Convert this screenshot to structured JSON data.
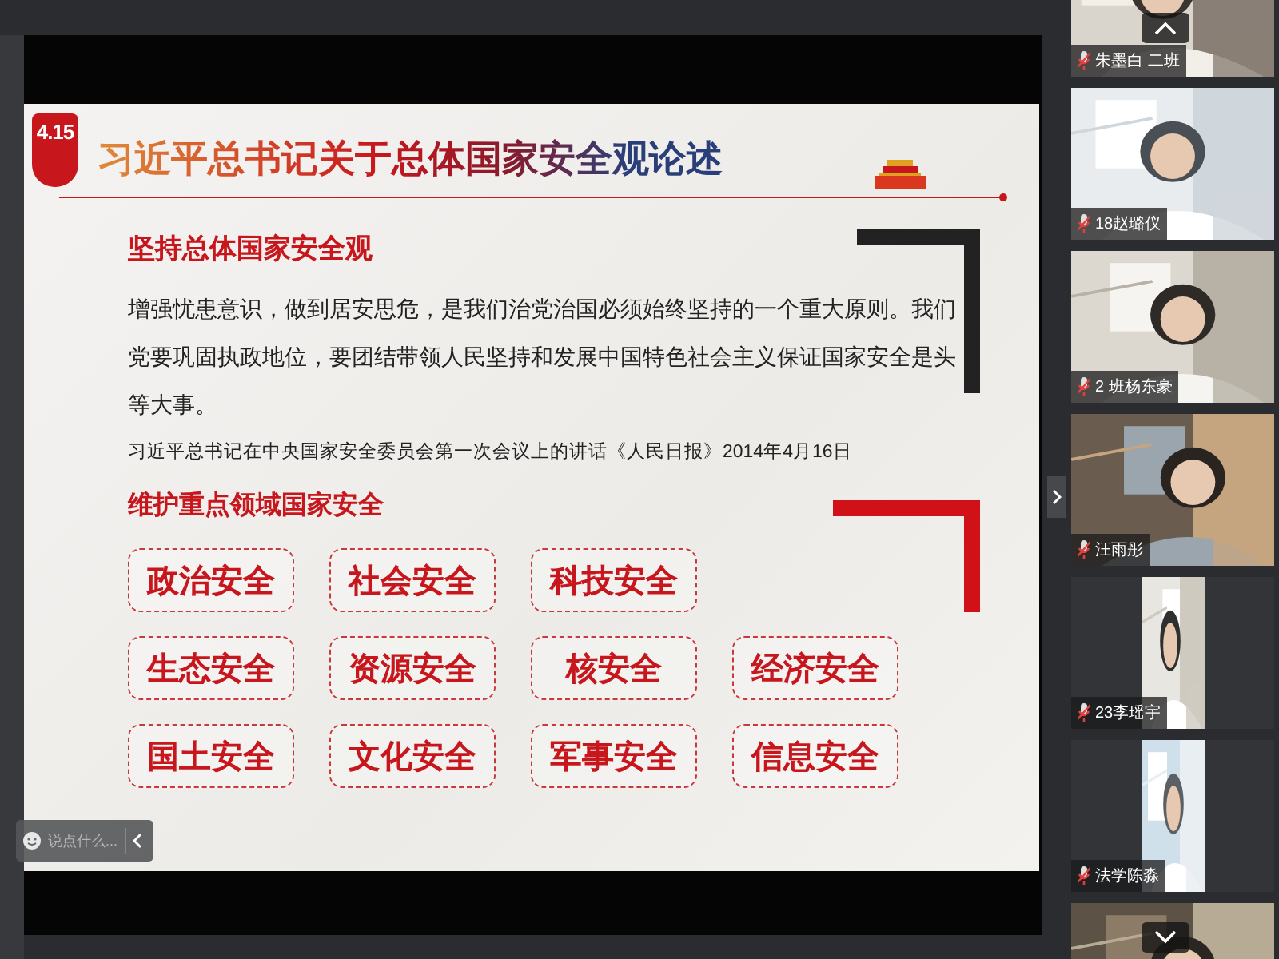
{
  "slide": {
    "logo_text": "4.15",
    "title": "习近平总书记关于总体国家安全观论述",
    "heading": "坚持总体国家安全观",
    "body": "增强忧患意识，做到居安思危，是我们治党治国必须始终坚持的一个重大原则。我们党要巩固执政地位，要团结带领人民坚持和发展中国特色社会主义保证国家安全是头等大事。",
    "citation": "习近平总书记在中央国家安全委员会第一次会议上的讲话《人民日报》2014年4月16日",
    "subheading": "维护重点领域国家安全",
    "areas": [
      [
        "政治安全",
        "社会安全",
        "科技安全"
      ],
      [
        "生态安全",
        "资源安全",
        "核安全",
        "经济安全"
      ],
      [
        "国土安全",
        "文化安全",
        "军事安全",
        "信息安全"
      ]
    ]
  },
  "chat": {
    "placeholder": "说点什么..."
  },
  "participants": [
    {
      "name": "朱墨白 二班",
      "kind": "wide"
    },
    {
      "name": "18赵璐仪",
      "kind": "wide"
    },
    {
      "name": "2 班杨东豪",
      "kind": "wide"
    },
    {
      "name": "汪雨彤",
      "kind": "wide"
    },
    {
      "name": "23李瑶宇",
      "kind": "narrow"
    },
    {
      "name": "法学陈淼",
      "kind": "narrow"
    },
    {
      "kind": "wide"
    }
  ]
}
